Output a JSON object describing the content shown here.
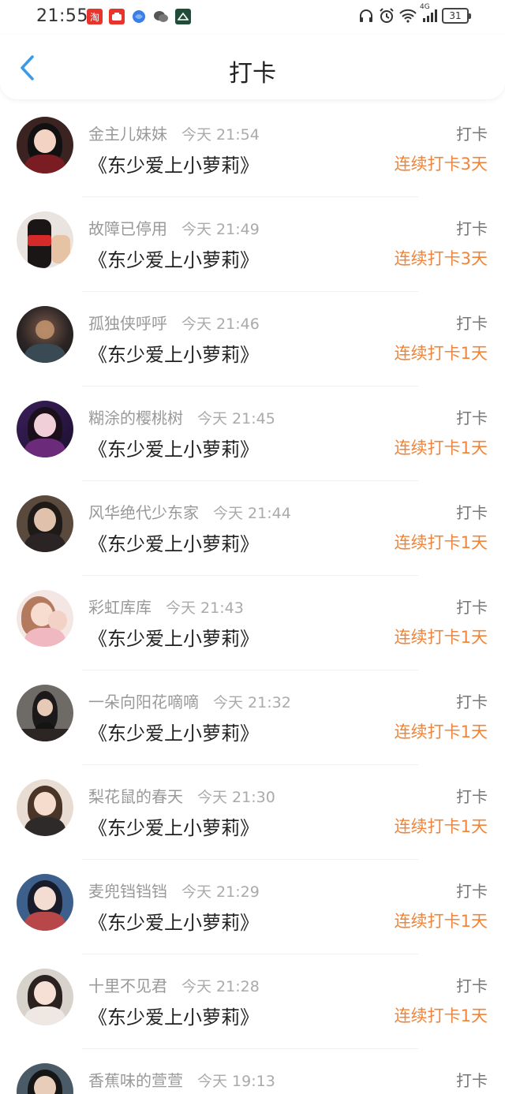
{
  "status_bar": {
    "time": "21:55",
    "network": "4G",
    "battery": "31",
    "notification_icons": [
      "taobao-icon",
      "pinduoduo-icon",
      "browser-icon",
      "wechat-icon",
      "app-icon"
    ]
  },
  "header": {
    "title": "打卡",
    "back_icon": "chevron-left-icon"
  },
  "colors": {
    "accent": "#3a9ae8",
    "streak": "#f0843a",
    "username": "#999999",
    "book": "#222222"
  },
  "checkins": [
    {
      "user": "金主儿妹妹",
      "time": "今天 21:54",
      "book": "《东少爱上小萝莉》",
      "action": "打卡",
      "streak": "连续打卡3天"
    },
    {
      "user": "故障已停用",
      "time": "今天 21:49",
      "book": "《东少爱上小萝莉》",
      "action": "打卡",
      "streak": "连续打卡3天"
    },
    {
      "user": "孤独侠呼呼",
      "time": "今天 21:46",
      "book": "《东少爱上小萝莉》",
      "action": "打卡",
      "streak": "连续打卡1天"
    },
    {
      "user": "糊涂的樱桃树",
      "time": "今天 21:45",
      "book": "《东少爱上小萝莉》",
      "action": "打卡",
      "streak": "连续打卡1天"
    },
    {
      "user": "风华绝代少东家",
      "time": "今天 21:44",
      "book": "《东少爱上小萝莉》",
      "action": "打卡",
      "streak": "连续打卡1天"
    },
    {
      "user": "彩虹库库",
      "time": "今天 21:43",
      "book": "《东少爱上小萝莉》",
      "action": "打卡",
      "streak": "连续打卡1天"
    },
    {
      "user": "一朵向阳花嘀嘀",
      "time": "今天 21:32",
      "book": "《东少爱上小萝莉》",
      "action": "打卡",
      "streak": "连续打卡1天"
    },
    {
      "user": "梨花鼠的春天",
      "time": "今天 21:30",
      "book": "《东少爱上小萝莉》",
      "action": "打卡",
      "streak": "连续打卡1天"
    },
    {
      "user": "麦兜铛铛铛",
      "time": "今天 21:29",
      "book": "《东少爱上小萝莉》",
      "action": "打卡",
      "streak": "连续打卡1天"
    },
    {
      "user": "十里不见君",
      "time": "今天 21:28",
      "book": "《东少爱上小萝莉》",
      "action": "打卡",
      "streak": "连续打卡1天"
    },
    {
      "user": "香蕉味的萱萱",
      "time": "今天 19:13",
      "book": "",
      "action": "打卡",
      "streak": ""
    }
  ]
}
